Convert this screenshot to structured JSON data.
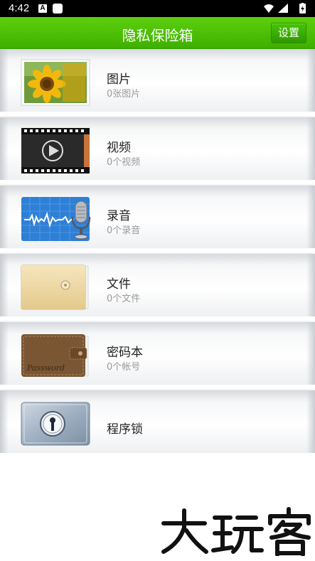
{
  "status_bar": {
    "time": "4:42",
    "badge": "A"
  },
  "header": {
    "title": "隐私保险箱",
    "settings_label": "设置",
    "accent_color": "#4cbd05"
  },
  "items": [
    {
      "name": "图片",
      "count": "0张图片",
      "icon": "sunflower-photo-icon"
    },
    {
      "name": "视频",
      "count": "0个视频",
      "icon": "film-strip-play-icon"
    },
    {
      "name": "录音",
      "count": "0个录音",
      "icon": "waveform-microphone-icon"
    },
    {
      "name": "文件",
      "count": "0个文件",
      "icon": "envelope-folder-icon"
    },
    {
      "name": "密码本",
      "count": "0个帐号",
      "icon": "leather-wallet-icon"
    },
    {
      "name": "程序锁",
      "count": "",
      "icon": "keyhole-lock-icon"
    }
  ]
}
